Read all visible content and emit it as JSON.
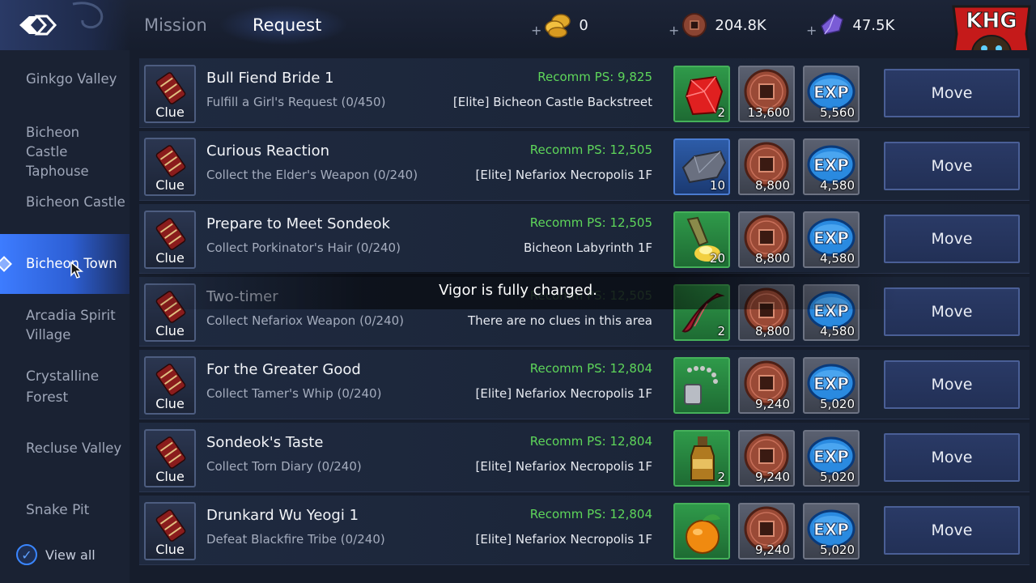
{
  "tabs": [
    {
      "label": "Mission",
      "active": false
    },
    {
      "label": "Request",
      "active": true
    }
  ],
  "currencies": [
    {
      "icon": "gold-coins-icon",
      "value": "0"
    },
    {
      "icon": "copper-coin-icon",
      "value": "204.8K"
    },
    {
      "icon": "purple-crystal-icon",
      "value": "47.5K"
    }
  ],
  "logo_text": "KHG",
  "sidebar": {
    "items": [
      {
        "label": "Ginkgo Valley"
      },
      {
        "label": "Bicheon Castle Taphouse"
      },
      {
        "label": "Bicheon Castle"
      },
      {
        "label": "Bicheon Town",
        "active": true
      },
      {
        "label": "Arcadia Spirit Village"
      },
      {
        "label": "Crystalline Forest"
      },
      {
        "label": "Recluse Valley"
      },
      {
        "label": "Snake Pit"
      }
    ],
    "view_all": {
      "label": "View all",
      "checked": true
    }
  },
  "quests": [
    {
      "clue": "Clue",
      "title": "Bull Fiend Bride 1",
      "subtitle": "Fulfill a Girl's Request (0/450)",
      "ps": "Recomm PS: 9,825",
      "location": "[Elite] Bicheon Castle Backstreet",
      "item": {
        "icon": "red-gem-icon",
        "count": "2",
        "rarity": "green"
      },
      "coins": "13,600",
      "exp": "5,560",
      "button": "Move"
    },
    {
      "clue": "Clue",
      "title": "Curious Reaction",
      "subtitle": "Collect the Elder's Weapon (0/240)",
      "ps": "Recomm PS: 12,505",
      "location": "[Elite] Nefariox Necropolis 1F",
      "item": {
        "icon": "iron-ore-icon",
        "count": "10",
        "rarity": "blue"
      },
      "coins": "8,800",
      "exp": "4,580",
      "button": "Move"
    },
    {
      "clue": "Clue",
      "title": "Prepare to Meet Sondeok",
      "subtitle": "Collect Porkinator's Hair (0/240)",
      "ps": "Recomm PS: 12,505",
      "location": "Bicheon Labyrinth 1F",
      "item": {
        "icon": "golden-potion-icon",
        "count": "20",
        "rarity": "green"
      },
      "coins": "8,800",
      "exp": "4,580",
      "button": "Move"
    },
    {
      "clue": "Clue",
      "title": "Two-timer",
      "subtitle": "Collect Nefariox Weapon (0/240)",
      "ps": "Recomm PS: 12,505",
      "location": "There are no clues in this area",
      "item": {
        "icon": "red-horn-icon",
        "count": "2",
        "rarity": "green"
      },
      "coins": "8,800",
      "exp": "4,580",
      "button": "Move",
      "dimmed": true
    },
    {
      "clue": "Clue",
      "title": "For the Greater Good",
      "subtitle": "Collect Tamer's Whip (0/240)",
      "ps": "Recomm PS: 12,804",
      "location": "[Elite] Nefariox Necropolis 1F",
      "item": {
        "icon": "dog-tag-icon",
        "count": "",
        "rarity": "green"
      },
      "coins": "9,240",
      "exp": "5,020",
      "button": "Move"
    },
    {
      "clue": "Clue",
      "title": "Sondeok's Taste",
      "subtitle": "Collect Torn Diary (0/240)",
      "ps": "Recomm PS: 12,804",
      "location": "[Elite] Nefariox Necropolis 1F",
      "item": {
        "icon": "wine-bottle-icon",
        "count": "2",
        "rarity": "green"
      },
      "coins": "9,240",
      "exp": "5,020",
      "button": "Move"
    },
    {
      "clue": "Clue",
      "title": "Drunkard Wu Yeogi 1",
      "subtitle": "Defeat Blackfire Tribe (0/240)",
      "ps": "Recomm PS: 12,804",
      "location": "[Elite] Nefariox Necropolis 1F",
      "item": {
        "icon": "orange-fruit-icon",
        "count": "",
        "rarity": "green"
      },
      "coins": "9,240",
      "exp": "5,020",
      "button": "Move"
    }
  ],
  "exp_label": "EXP",
  "toast": "Vigor is fully charged.",
  "colors": {
    "accent": "#3d7cff",
    "recomm_ps": "#5ed65a",
    "button_bg": "#2a3a66"
  }
}
